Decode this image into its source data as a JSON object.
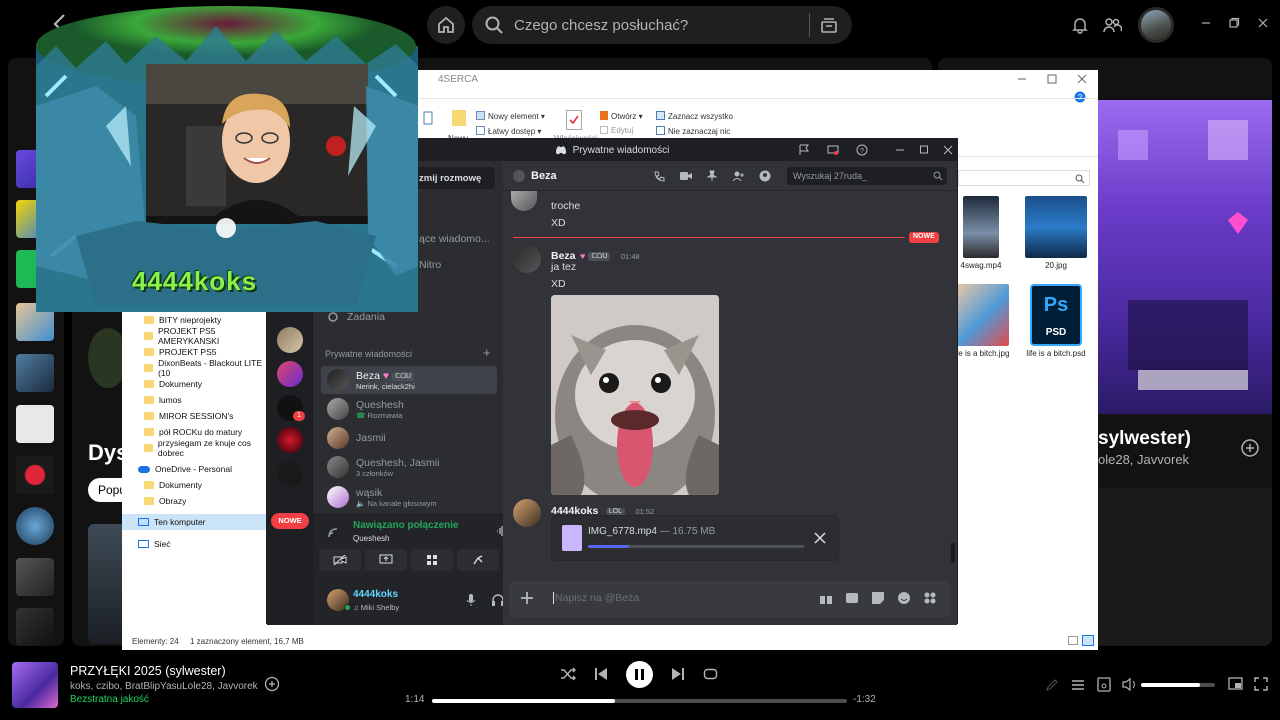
{
  "spotify": {
    "search_placeholder": "Czego chcesz posłuchać?",
    "main": {
      "heading_partial": "Dys",
      "chip_partial": "Popu"
    },
    "now_playing_panel": {
      "title_partial": "sylwester)",
      "artists_partial": "ole28, Javvorek"
    },
    "player": {
      "title": "PRZYŁĘKI 2025 (sylwester)",
      "artists": "koks, czibo, BratBlipYasuLole28, Javvorek",
      "quality": "Bezstratna jakość",
      "elapsed": "1:14",
      "remaining": "-1:32",
      "progress": 0.44,
      "volume": 0.8
    }
  },
  "explorer": {
    "folder_title": "4SERCA",
    "ribbon": {
      "new_item": "Nowy element",
      "easy_access": "Łatwy dostęp",
      "open": "Otwórz",
      "edit": "Edytuj",
      "select_all": "Zaznacz wszystko",
      "select_none": "Nie zaznaczaj nic",
      "new_label": "Nowy",
      "properties_label": "Właściwości"
    },
    "tree": [
      "BITY nieprojekty",
      "PROJEKT PS5 AMERYKANSKI",
      "PROJEKT PS5",
      "DixonBeats - Blackout LITE (10",
      "Dokumenty",
      "lumos",
      "MIROR SESSION's",
      "pół ROCKu do matury",
      "przysiegam ze knuje cos dobrec",
      "OneDrive - Personal",
      "Dokumenty",
      "Obrazy",
      "Ten komputer",
      "Sieć"
    ],
    "files": [
      {
        "name": "4swag.mp4"
      },
      {
        "name": "20.jpg"
      },
      {
        "name": "life is a bitch.jpg"
      },
      {
        "name": "life is a bitch.psd"
      }
    ],
    "psd_label": "PSD",
    "ps_label": "Ps",
    "status": {
      "count": "Elementy: 24",
      "selected": "1 zaznaczony element, 16,7 MB"
    }
  },
  "discord": {
    "window_title": "Prywatne wiadomości",
    "channels": {
      "start_conversation_partial": "zmij rozmowę",
      "messages_partial": "ące wiadomo...",
      "nitro_partial": "Nitro",
      "tasks": "Zadania",
      "dm_header": "Prywatne wiadomości",
      "new_badge": "NOWE",
      "dms": [
        {
          "name": "Beza",
          "badge": "ᑕᗝᑌ",
          "sub": "Nerink, cielack2hi"
        },
        {
          "name": "Queshesh",
          "sub": "Rozmawia"
        },
        {
          "name": "Jasmii",
          "sub": ""
        },
        {
          "name": "Queshesh, Jasmii",
          "sub": "3 członków"
        },
        {
          "name": "wąsik",
          "sub": "Na kanale głosowym"
        }
      ],
      "voice": {
        "status": "Nawiązano połączenie",
        "channel": "Queshesh"
      },
      "user": {
        "name": "4444koks",
        "status": "Miki Shelby"
      }
    },
    "chat": {
      "recipient": "Beza",
      "search_placeholder": "Wyszukaj 27ruda_",
      "new_divider": "NOWE",
      "messages": [
        {
          "text": "troche"
        },
        {
          "text": "XD"
        },
        {
          "author": "Beza",
          "tag": "ᑕᗝᑌ",
          "time": "01:48",
          "lines": [
            "ja tez",
            "XD"
          ]
        },
        {
          "author": "4444koks",
          "tag": "LOL",
          "time": "01:52"
        }
      ],
      "upload": {
        "filename": "IMG_6778.mp4",
        "size": "— 16.75 MB",
        "progress": 0.19
      },
      "input_placeholder": "Napisz na @Beza"
    }
  },
  "overlay": {
    "streamer_name": "4444koks"
  }
}
